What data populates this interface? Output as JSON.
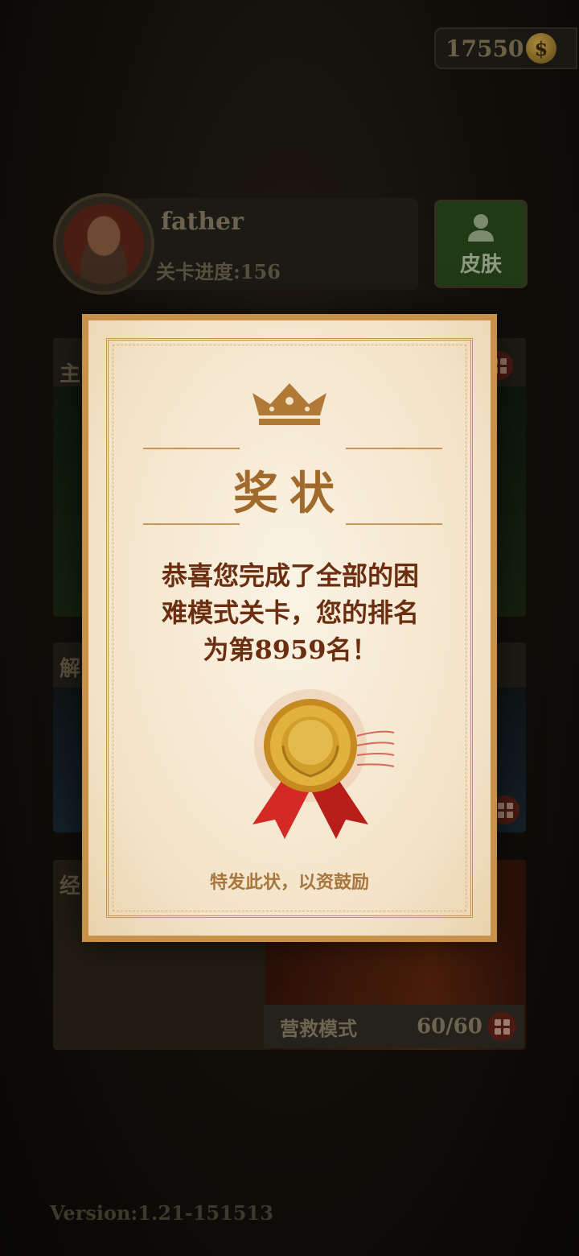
{
  "header": {
    "coins": "17550",
    "coin_symbol": "$"
  },
  "profile": {
    "name": "father",
    "progress": "关卡进度:156",
    "skin_label": "皮肤"
  },
  "modes": {
    "card1_edge": "主",
    "card2_edge": "解",
    "card3_edge": "经",
    "rescue": {
      "name": "营救模式",
      "count": "60/60"
    }
  },
  "certificate": {
    "title": "奖状",
    "message": "恭喜您完成了全部的困难模式关卡，您的排名为第8959名！",
    "footer": "特发此状，以资鼓励"
  },
  "footer": {
    "version": "Version:1.21-151513"
  },
  "colors": {
    "paper": "#f3e3c8",
    "gold": "#c69758",
    "text_red": "#6b2e10",
    "medal_red": "#d42a24"
  }
}
